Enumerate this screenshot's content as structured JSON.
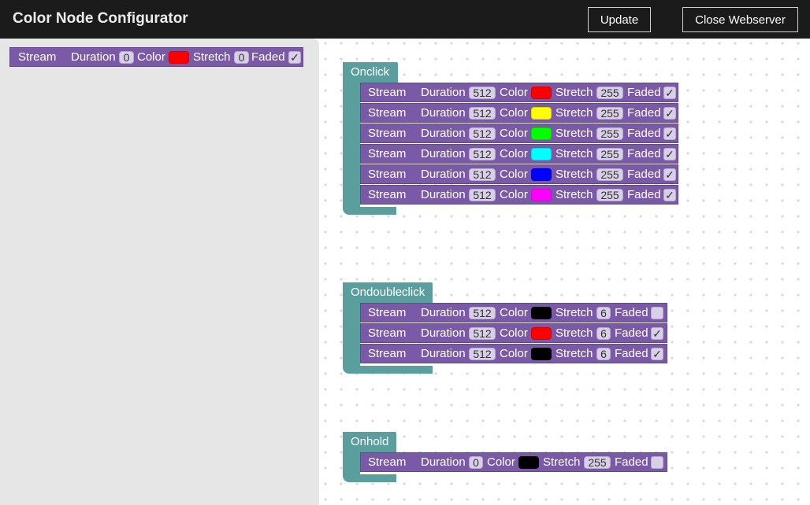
{
  "header": {
    "title": "Color Node Configurator",
    "update_label": "Update",
    "close_label": "Close Webserver"
  },
  "toolbox_block": {
    "stream": "Stream",
    "duration_label": "Duration",
    "duration": "0",
    "color_label": "Color",
    "color": "#ff0000",
    "stretch_label": "Stretch",
    "stretch": "0",
    "faded_label": "Faded",
    "faded": "✓"
  },
  "events": {
    "onclick": {
      "label": "Onclick",
      "rows": [
        {
          "stream": "Stream",
          "duration_label": "Duration",
          "duration": "512",
          "color_label": "Color",
          "color": "#ff0000",
          "stretch_label": "Stretch",
          "stretch": "255",
          "faded_label": "Faded",
          "faded": "✓"
        },
        {
          "stream": "Stream",
          "duration_label": "Duration",
          "duration": "512",
          "color_label": "Color",
          "color": "#ffff00",
          "stretch_label": "Stretch",
          "stretch": "255",
          "faded_label": "Faded",
          "faded": "✓"
        },
        {
          "stream": "Stream",
          "duration_label": "Duration",
          "duration": "512",
          "color_label": "Color",
          "color": "#00ff00",
          "stretch_label": "Stretch",
          "stretch": "255",
          "faded_label": "Faded",
          "faded": "✓"
        },
        {
          "stream": "Stream",
          "duration_label": "Duration",
          "duration": "512",
          "color_label": "Color",
          "color": "#00ffff",
          "stretch_label": "Stretch",
          "stretch": "255",
          "faded_label": "Faded",
          "faded": "✓"
        },
        {
          "stream": "Stream",
          "duration_label": "Duration",
          "duration": "512",
          "color_label": "Color",
          "color": "#0000ff",
          "stretch_label": "Stretch",
          "stretch": "255",
          "faded_label": "Faded",
          "faded": "✓"
        },
        {
          "stream": "Stream",
          "duration_label": "Duration",
          "duration": "512",
          "color_label": "Color",
          "color": "#ff00ff",
          "stretch_label": "Stretch",
          "stretch": "255",
          "faded_label": "Faded",
          "faded": "✓"
        }
      ]
    },
    "ondoubleclick": {
      "label": "Ondoubleclick",
      "rows": [
        {
          "stream": "Stream",
          "duration_label": "Duration",
          "duration": "512",
          "color_label": "Color",
          "color": "#000000",
          "stretch_label": "Stretch",
          "stretch": "6",
          "faded_label": "Faded",
          "faded": ""
        },
        {
          "stream": "Stream",
          "duration_label": "Duration",
          "duration": "512",
          "color_label": "Color",
          "color": "#ff0000",
          "stretch_label": "Stretch",
          "stretch": "6",
          "faded_label": "Faded",
          "faded": "✓"
        },
        {
          "stream": "Stream",
          "duration_label": "Duration",
          "duration": "512",
          "color_label": "Color",
          "color": "#000000",
          "stretch_label": "Stretch",
          "stretch": "6",
          "faded_label": "Faded",
          "faded": "✓"
        }
      ]
    },
    "onhold": {
      "label": "Onhold",
      "rows": [
        {
          "stream": "Stream",
          "duration_label": "Duration",
          "duration": "0",
          "color_label": "Color",
          "color": "#000000",
          "stretch_label": "Stretch",
          "stretch": "255",
          "faded_label": "Faded",
          "faded": ""
        }
      ]
    }
  }
}
